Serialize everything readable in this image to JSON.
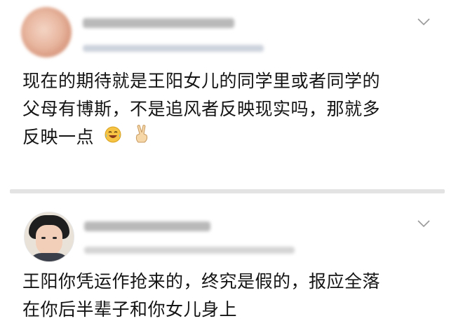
{
  "comments": [
    {
      "text_lines": [
        "现在的期待就是王阳女儿的同学里或者同学的",
        "父母有博斯，不是追风者反映现实吗，那就多",
        "反映一点"
      ],
      "emojis": [
        "laugh-crying-emoji-icon",
        "victory-hand-emoji-icon"
      ]
    },
    {
      "text_lines": [
        "王阳你凭运作抢来的，终究是假的，报应全落",
        "在你后半辈子和你女儿身上"
      ]
    }
  ],
  "colors": {
    "text": "#141414",
    "divider": "#e3e3e3",
    "chevron": "#9a9a9a"
  }
}
